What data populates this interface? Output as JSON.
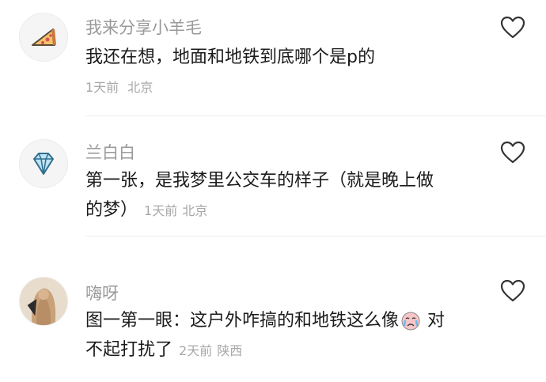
{
  "comments": [
    {
      "username": "我来分享小羊毛",
      "text": "我还在想，地面和地铁到底哪个是p的",
      "time": "1天前",
      "location": "北京",
      "avatar_icon": "pizza-icon"
    },
    {
      "username": "兰白白",
      "text_line1": "第一张，是我梦里公交车的样子（就是晚上做",
      "text_line2": "的梦）",
      "time": "1天前",
      "location": "北京",
      "avatar_icon": "diamond-icon"
    },
    {
      "username": "嗨呀",
      "text_part1": "图一第一眼：这户外咋搞的和地铁这么像",
      "text_part2": "对",
      "text_line2": "不起打扰了",
      "time": "2天前",
      "location": "陕西",
      "emoji": "crying-face-emoji",
      "avatar_icon": "user-photo"
    }
  ],
  "icons": {
    "like": "heart-outline-icon"
  },
  "colors": {
    "username": "#9a9a9a",
    "meta": "#a7a7a7",
    "text": "#1b1b1b",
    "divider": "#eeeeee"
  }
}
